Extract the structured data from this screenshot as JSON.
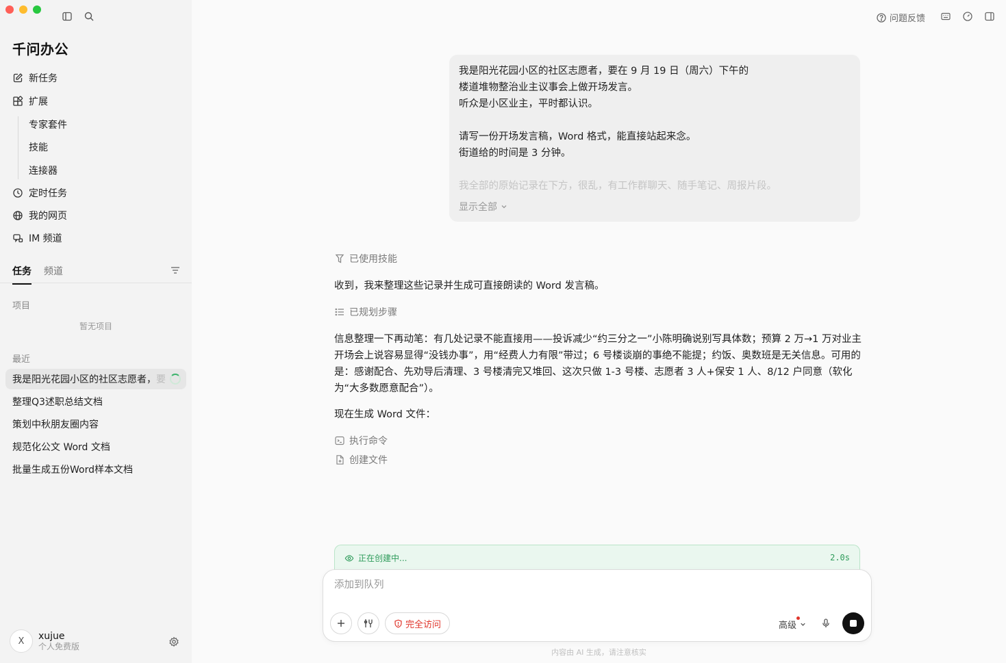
{
  "sidebar": {
    "brand": "千问办公",
    "nav": {
      "new_task": "新任务",
      "extensions": "扩展",
      "expert_suite": "专家套件",
      "skills": "技能",
      "connectors": "连接器",
      "scheduled": "定时任务",
      "my_pages": "我的网页",
      "im_channel": "IM 频道"
    },
    "tabs": {
      "tasks": "任务",
      "channels": "频道"
    },
    "projects_label": "项目",
    "projects_empty": "暂无项目",
    "recent_label": "最近",
    "recent": [
      {
        "title": "我是阳光花园小区的社区志愿者，",
        "fade": "要"
      },
      {
        "title": "整理Q3述职总结文档"
      },
      {
        "title": "策划中秋朋友圈内容"
      },
      {
        "title": "规范化公文 Word 文档"
      },
      {
        "title": "批量生成五份Word样本文档"
      }
    ],
    "user": {
      "initial": "X",
      "name": "xujue",
      "plan": "个人免费版"
    }
  },
  "topbar": {
    "feedback": "问题反馈"
  },
  "chat": {
    "user_message": {
      "lines": [
        "我是阳光花园小区的社区志愿者，要在 9 月 19 日（周六）下午的",
        "楼道堆物整治业主议事会上做开场发言。",
        "听众是小区业主，平时都认识。",
        "请写一份开场发言稿，Word 格式，能直接站起来念。",
        "街道给的时间是 3 分钟。",
        "我全部的原始记录在下方，很乱，有工作群聊天、随手笔记、周报片段。"
      ],
      "show_all": "显示全部"
    },
    "used_skill": "已使用技能",
    "reply_1": "收到，我来整理这些记录并生成可直接朗读的 Word 发言稿。",
    "planned_steps": "已规划步骤",
    "reply_2": "信息整理一下再动笔：有几处记录不能直接用——投诉减少“约三分之一”小陈明确说别写具体数；预算 2 万→1 万对业主开场会上说容易显得“没钱办事”，用“经费人力有限”带过；6 号楼谈崩的事绝不能提；约饭、奥数班是无关信息。可用的是：感谢配合、先劝导后清理、3 号楼清完又堆回、这次只做 1-3 号楼、志愿者 3 人+保安 1 人、8/12 户同意（软化为“大多数愿意配合”）。",
    "reply_3": "现在生成 Word 文件：",
    "step_command": "执行命令",
    "step_file": "创建文件"
  },
  "status": {
    "text": "正在创建中...",
    "time": "2.0s"
  },
  "composer": {
    "placeholder": "添加到队列",
    "access": "完全访问",
    "level": "高级"
  },
  "disclaimer": "内容由 AI 生成，请注意核实"
}
